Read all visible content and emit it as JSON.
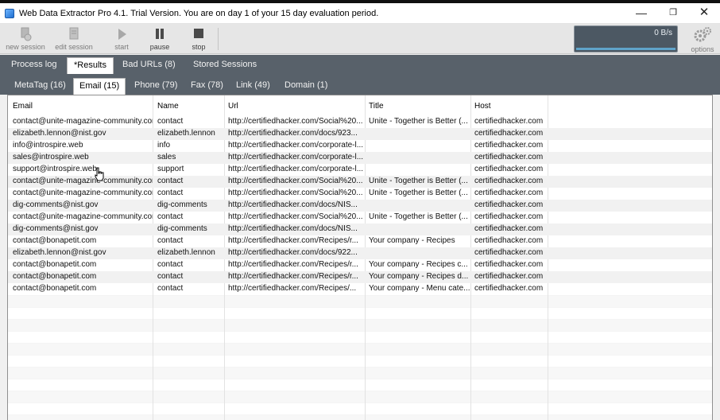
{
  "window": {
    "title": "Web Data Extractor Pro 4.1. Trial Version. You are on day 1 of your 15 day evaluation period.",
    "controls": {
      "minimize": "—",
      "maximize": "❐",
      "close": "✕"
    }
  },
  "toolbar": {
    "new_session": "new session",
    "edit_session": "edit session",
    "start": "start",
    "pause": "pause",
    "stop": "stop",
    "speed": "0 B/s",
    "options": "options"
  },
  "main_tabs": [
    "Process log",
    "*Results",
    "Bad URLs (8)",
    "Stored Sessions"
  ],
  "sub_tabs": [
    "MetaTag (16)",
    "Email (15)",
    "Phone (79)",
    "Fax (78)",
    "Link (49)",
    "Domain (1)"
  ],
  "grid": {
    "columns": [
      "Email",
      "Name",
      "Url",
      "Title",
      "Host"
    ],
    "rows": [
      [
        "contact@unite-magazine-community.com",
        "contact",
        "http://certifiedhacker.com/Social%20...",
        "Unite - Together is Better (...",
        "certifiedhacker.com"
      ],
      [
        "elizabeth.lennon@nist.gov",
        "elizabeth.lennon",
        "http://certifiedhacker.com/docs/923...",
        "",
        "certifiedhacker.com"
      ],
      [
        "info@introspire.web",
        "info",
        "http://certifiedhacker.com/corporate-l...",
        "",
        "certifiedhacker.com"
      ],
      [
        "sales@introspire.web",
        "sales",
        "http://certifiedhacker.com/corporate-l...",
        "",
        "certifiedhacker.com"
      ],
      [
        "support@introspire.web",
        "support",
        "http://certifiedhacker.com/corporate-l...",
        "",
        "certifiedhacker.com"
      ],
      [
        "contact@unite-magazine-community.com",
        "contact",
        "http://certifiedhacker.com/Social%20...",
        "Unite - Together is Better (...",
        "certifiedhacker.com"
      ],
      [
        "contact@unite-magazine-community.com",
        "contact",
        "http://certifiedhacker.com/Social%20...",
        "Unite - Together is Better (...",
        "certifiedhacker.com"
      ],
      [
        "dig-comments@nist.gov",
        "dig-comments",
        "http://certifiedhacker.com/docs/NIS...",
        "",
        "certifiedhacker.com"
      ],
      [
        "contact@unite-magazine-community.com",
        "contact",
        "http://certifiedhacker.com/Social%20...",
        "Unite - Together is Better (...",
        "certifiedhacker.com"
      ],
      [
        "dig-comments@nist.gov",
        "dig-comments",
        "http://certifiedhacker.com/docs/NIS...",
        "",
        "certifiedhacker.com"
      ],
      [
        "contact@bonapetit.com",
        "contact",
        "http://certifiedhacker.com/Recipes/r...",
        "Your company - Recipes",
        "certifiedhacker.com"
      ],
      [
        "elizabeth.lennon@nist.gov",
        "elizabeth.lennon",
        "http://certifiedhacker.com/docs/922...",
        "",
        "certifiedhacker.com"
      ],
      [
        "contact@bonapetit.com",
        "contact",
        "http://certifiedhacker.com/Recipes/r...",
        "Your company - Recipes c...",
        "certifiedhacker.com"
      ],
      [
        "contact@bonapetit.com",
        "contact",
        "http://certifiedhacker.com/Recipes/r...",
        "Your company - Recipes d...",
        "certifiedhacker.com"
      ],
      [
        "contact@bonapetit.com",
        "contact",
        "http://certifiedhacker.com/Recipes/...",
        "Your company - Menu cate...",
        "certifiedhacker.com"
      ]
    ]
  },
  "colors": {
    "tab_strip": "#58616a",
    "speed_panel": "#4c5863",
    "row_alt": "#f1f1f1"
  }
}
